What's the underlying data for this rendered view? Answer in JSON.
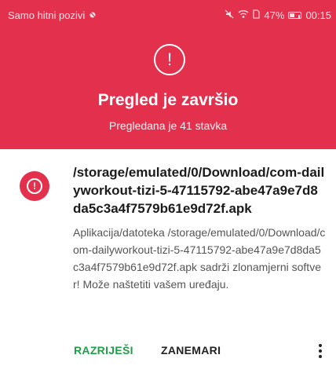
{
  "statusbar": {
    "carrier": "Samo hitni pozivi",
    "battery": "47%",
    "time": "00:15",
    "battery_level": 0.47
  },
  "header": {
    "title": "Pregled je završio",
    "subtitle": "Pregledana je 41 stavka",
    "background_color": "#e2304d"
  },
  "threat": {
    "path": "/storage/emulated/0/Download/com-dailyworkout-tizi-5-47115792-abe47a9e7d8da5c3a4f7579b61e9d72f.apk",
    "description": "Aplikacija/datoteka /storage/emulated/0/Download/com-dailyworkout-tizi-5-47115792-abe47a9e7d8da5c3a4f7579b61e9d72f.apk sadrži zlonamjerni softver! Može naštetiti vašem uređaju."
  },
  "actions": {
    "resolve_label": "RAZRIJEŠI",
    "ignore_label": "ZANEMARI",
    "resolve_color": "#1f9d48"
  }
}
